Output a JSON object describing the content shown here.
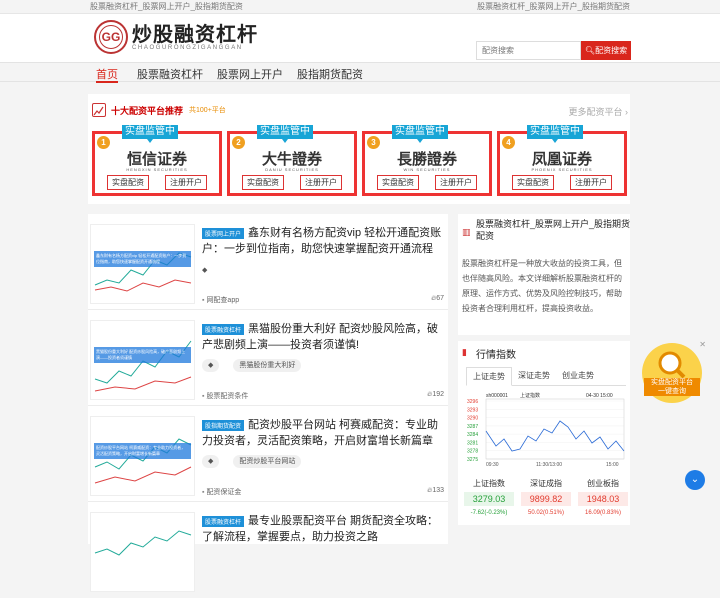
{
  "topbar": {
    "left": "股票融资杠杆_股票网上开户_股指期货配资",
    "right": "股票融资杠杆_股票网上开户_股指期货配资"
  },
  "logo": {
    "cn": "炒股融资杠杆",
    "en": "CHAOGURONGZIGANGGAN",
    "mark": "GG"
  },
  "search": {
    "placeholder": "配资搜索",
    "button": "配资搜索"
  },
  "nav": [
    "首页",
    "股票融资杠杆",
    "股票网上开户",
    "股指期货配资"
  ],
  "platforms": {
    "title": "十大配资平台推荐",
    "count": "共100+平台",
    "more": "更多配资平台",
    "cards": [
      {
        "badge": "实盘监管中",
        "rank": "1",
        "name": "恒信证券",
        "sub": "HENGXIN SECURITIES",
        "color": "#c8102e",
        "b1": "实盘配资",
        "b2": "注册开户"
      },
      {
        "badge": "实盘监管中",
        "rank": "2",
        "name": "大牛證券",
        "sub": "DANIU SECURITIES",
        "color": "#111111",
        "b1": "实盘配资",
        "b2": "注册开户"
      },
      {
        "badge": "实盘监管中",
        "rank": "3",
        "name": "長勝證券",
        "sub": "WIN SECURITIES",
        "color": "#1a3f8c",
        "b1": "实盘配资",
        "b2": "注册开户"
      },
      {
        "badge": "实盘监管中",
        "rank": "4",
        "name": "凤凰证券",
        "sub": "PHOENIX SECURITIES",
        "color": "#1a2a6c",
        "b1": "实盘配资",
        "b2": "注册开户"
      }
    ]
  },
  "feed": [
    {
      "tag": "股票网上开户",
      "title": "鑫东财有名杨方配资vip 轻松开通配资账户：一步到位指南，助您快速掌握配资开通流程",
      "kw": "",
      "cat": "网配查app",
      "views": "67",
      "thumb": "鑫东财有名杨方配资vip 轻松开通配资账户：一步到位指南，助您快速掌握配资开通流程"
    },
    {
      "tag": "股票融资杠杆",
      "title": "黑猫股份重大利好 配资炒股风险高，破产悲剧频上演——投资者须谨慎!",
      "kw": "黑猫股份重大利好",
      "cat": "股票配资条件",
      "views": "192",
      "thumb": "黑猫股份重大利好 配资炒股风险高，破产悲剧频上演——投资者须谨慎"
    },
    {
      "tag": "股指期货配资",
      "title": "配资炒股平台网站 柯赛威配资：专业助力投资者，灵活配资策略，开启财富增长新篇章",
      "kw": "配资炒股平台网站",
      "cat": "配资保证金",
      "views": "133",
      "thumb": "配资炒股平台网站 柯赛威配资：专业助力投资者，灵活配资策略，开启财富增长新篇章"
    },
    {
      "tag": "股票融资杠杆",
      "title": "最专业股票配资平台 期货配资全攻略：了解流程，掌握要点，助力投资之路",
      "kw": "",
      "cat": "",
      "views": "",
      "thumb": ""
    }
  ],
  "side": {
    "head": "股票融资杠杆_股票网上开户_股指期货配资",
    "desc": "股票融资杠杆是一种放大收益的投资工具，但也伴随高风险。本文详细解析股票融资杠杆的原理、运作方式、优势及风险控制技巧，帮助投资者合理利用杠杆，提高投资收益。",
    "index_title": "行情指数",
    "tabs": [
      "上证走势",
      "深证走势",
      "创业走势"
    ],
    "chart": {
      "code": "sh000001",
      "name": "上证指数",
      "time": "04-30 15:00",
      "yticks": [
        "3296",
        "3293",
        "3290",
        "3287",
        "3284",
        "3281",
        "3278",
        "3275"
      ],
      "xticks": [
        "09:30",
        "11:30/13:00",
        "15:00"
      ]
    },
    "quotes": [
      {
        "name": "上证指数",
        "value": "3279.03",
        "change": "-7.62(-0.23%)",
        "color": "#27a13b"
      },
      {
        "name": "深证成指",
        "value": "9899.82",
        "change": "50.02(0.51%)",
        "color": "#e23b2e"
      },
      {
        "name": "创业板指",
        "value": "1948.03",
        "change": "16.09(0.83%)",
        "color": "#e23b2e"
      }
    ]
  },
  "float": {
    "label": "实盘配资平台",
    "sub": "一键查询"
  }
}
